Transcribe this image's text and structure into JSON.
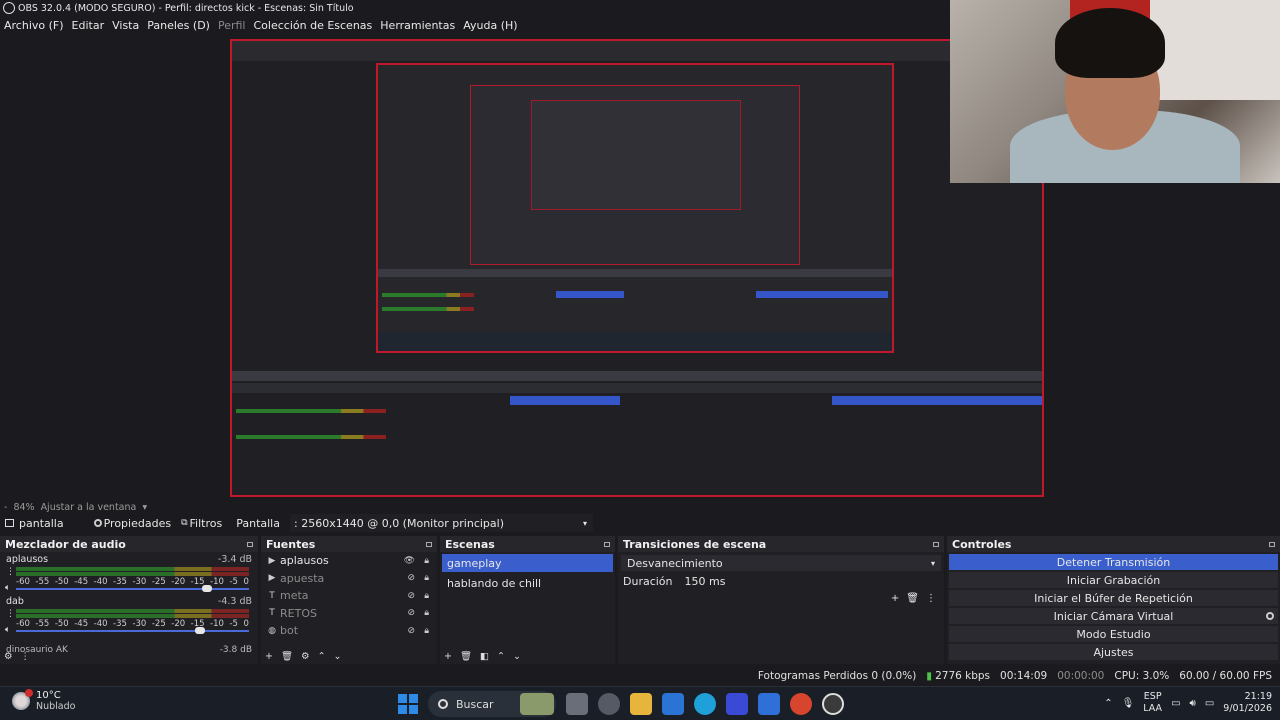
{
  "window": {
    "title": "OBS 32.0.4 (MODO SEGURO) - Perfil: directos kick - Escenas: Sin Título"
  },
  "menu": [
    "Archivo (F)",
    "Editar",
    "Vista",
    "Paneles (D)",
    "Perfil",
    "Colección de Escenas",
    "Herramientas",
    "Ayuda (H)"
  ],
  "preview": {
    "zoom": "84%",
    "fit_label": "Ajustar a la ventana"
  },
  "source_toolbar": {
    "source_name": "pantalla",
    "properties": "Propiedades",
    "filters": "Filtros",
    "type_label": "Pantalla",
    "display_value": ": 2560x1440 @ 0,0 (Monitor principal)"
  },
  "mixer": {
    "title": "Mezclador de audio",
    "scale": [
      "-60",
      "-55",
      "-50",
      "-45",
      "-40",
      "-35",
      "-30",
      "-25",
      "-20",
      "-15",
      "-10",
      "-5",
      "0"
    ],
    "channels": [
      {
        "name": "aplausos",
        "db": "-3.4 dB",
        "volume": 0.82
      },
      {
        "name": "dab",
        "db": "-4.3 dB",
        "volume": 0.79
      }
    ],
    "partial_channel": "dinosaurio AK",
    "partial_db": "-3.8 dB"
  },
  "sources": {
    "title": "Fuentes",
    "items": [
      {
        "label": "aplausos",
        "icon": "play-icon",
        "visible": true
      },
      {
        "label": "apuesta",
        "icon": "play-icon",
        "visible": false
      },
      {
        "label": "meta",
        "icon": "text-icon",
        "visible": false
      },
      {
        "label": "RETOS",
        "icon": "text-icon",
        "visible": false
      },
      {
        "label": "bot",
        "icon": "browser-icon",
        "visible": false
      }
    ]
  },
  "scenes": {
    "title": "Escenas",
    "items": [
      {
        "label": "gameplay",
        "active": true
      },
      {
        "label": "hablando de chill",
        "active": false
      }
    ]
  },
  "transitions": {
    "title": "Transiciones de escena",
    "selected": "Desvanecimiento",
    "duration_label": "Duración",
    "duration_value": "150 ms"
  },
  "controls": {
    "title": "Controles",
    "buttons": [
      {
        "label": "Detener Transmisión",
        "primary": true
      },
      {
        "label": "Iniciar Grabación",
        "primary": false
      },
      {
        "label": "Iniciar el Búfer de Repetición",
        "primary": false
      },
      {
        "label": "Iniciar Cámara Virtual",
        "primary": false
      },
      {
        "label": "Modo Estudio",
        "primary": false
      },
      {
        "label": "Ajustes",
        "primary": false
      }
    ]
  },
  "status": {
    "dropped": "Fotogramas Perdidos 0 (0.0%)",
    "bitrate": "2776 kbps",
    "stream_time": "00:14:09",
    "rec_time": "00:00:00",
    "cpu": "CPU: 3.0%",
    "fps": "60.00 / 60.00 FPS"
  },
  "taskbar": {
    "temp": "10°C",
    "weather": "Nublado",
    "search": "Buscar",
    "lang1": "ESP",
    "lang2": "LAA",
    "time": "21:19",
    "date": "9/01/2026"
  }
}
